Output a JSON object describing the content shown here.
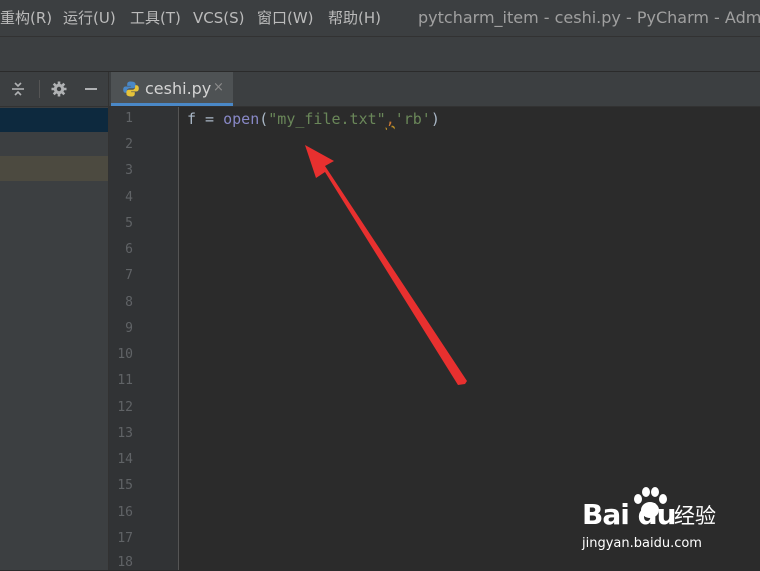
{
  "menubar": {
    "items": [
      "重构(R)",
      "运行(U)",
      "工具(T)",
      "VCS(S)",
      "窗口(W)",
      "帮助(H)"
    ],
    "window_title": "pytcharm_item - ceshi.py - PyCharm - Administ"
  },
  "project_panel": {
    "icons": [
      "collapse-all-icon",
      "gear-icon",
      "hide-icon"
    ]
  },
  "editor_tabs": [
    {
      "label": "ceshi.py",
      "icon": "python-file-icon",
      "close": "×",
      "active": true
    }
  ],
  "gutter": {
    "line_numbers": [
      "1",
      "2",
      "3",
      "4",
      "5",
      "6",
      "7",
      "8",
      "9",
      "10",
      "11",
      "12",
      "13",
      "14",
      "15",
      "16",
      "17",
      "18"
    ]
  },
  "code": {
    "line1": {
      "var": "f = ",
      "builtin": "open",
      "open_paren": "(",
      "arg1": "\"my_file.txt\"",
      "comma": ",",
      "arg2": "'rb'",
      "close_paren": ")"
    }
  },
  "annotation": {
    "arrow_color": "#e8302f"
  },
  "watermark": {
    "brand": "Bai du",
    "product": "经验",
    "url": "jingyan.baidu.com"
  },
  "colors": {
    "accent_tab": "#4a88c7",
    "selection_blue": "#0d293e",
    "selection_tan": "#4c4a40",
    "editor_bg": "#2b2b2b"
  }
}
